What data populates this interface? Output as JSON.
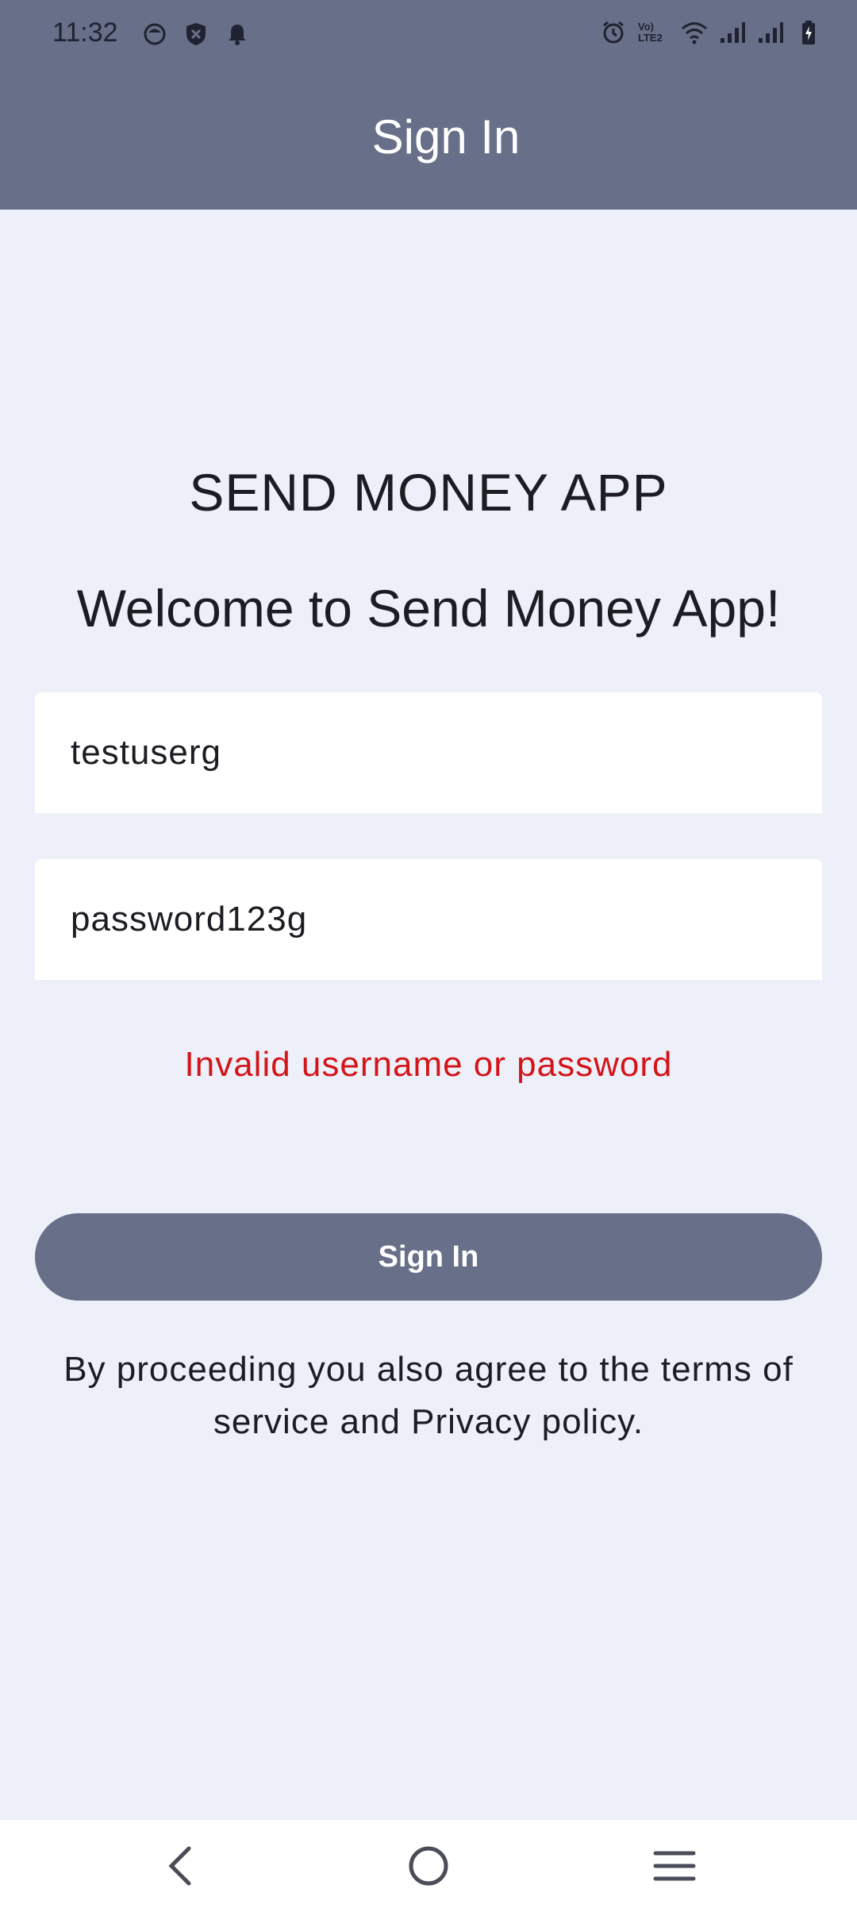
{
  "status_bar": {
    "time": "11:32",
    "network_label": "Vo) LTE2",
    "left_icons": [
      "face-icon",
      "shield-x-icon",
      "bell-icon"
    ],
    "right_icons": [
      "alarm-icon",
      "volte-icon",
      "wifi-icon",
      "signal-icon",
      "signal-icon",
      "battery-charging-icon"
    ]
  },
  "app_bar": {
    "title": "Sign In"
  },
  "main": {
    "app_name": "SEND MONEY APP",
    "welcome": "Welcome to Send Money App!",
    "username_value": "testuserg",
    "password_value": "password123g",
    "error_message": "Invalid username or password",
    "sign_in_label": "Sign In",
    "terms_text": "By proceeding you also agree to the terms of service and Privacy policy."
  },
  "nav_bar": {
    "buttons": [
      "back-icon",
      "home-icon",
      "menu-icon"
    ]
  },
  "colors": {
    "primary": "#686f88",
    "background": "#eef0f9",
    "error": "#d3151a",
    "field": "#ffffff"
  }
}
